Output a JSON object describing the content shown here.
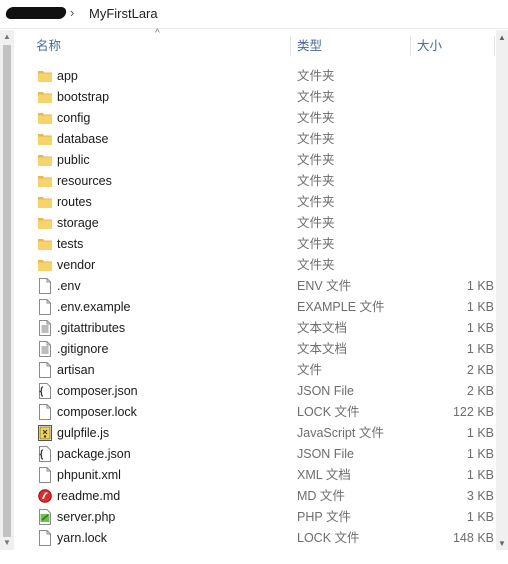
{
  "breadcrumb": {
    "separator": "›",
    "current_folder": "MyFirstLara"
  },
  "header": {
    "name": "名称",
    "type": "类型",
    "size": "大小",
    "sort_indicator": "^"
  },
  "colors": {
    "folder": "#f7d46a",
    "header_text": "#4a6a9a",
    "muted_text": "#6d6d6d"
  },
  "files": [
    {
      "name": "app",
      "type": "文件夹",
      "size": "",
      "icon": "folder-icon"
    },
    {
      "name": "bootstrap",
      "type": "文件夹",
      "size": "",
      "icon": "folder-icon"
    },
    {
      "name": "config",
      "type": "文件夹",
      "size": "",
      "icon": "folder-icon"
    },
    {
      "name": "database",
      "type": "文件夹",
      "size": "",
      "icon": "folder-icon"
    },
    {
      "name": "public",
      "type": "文件夹",
      "size": "",
      "icon": "folder-icon"
    },
    {
      "name": "resources",
      "type": "文件夹",
      "size": "",
      "icon": "folder-icon"
    },
    {
      "name": "routes",
      "type": "文件夹",
      "size": "",
      "icon": "folder-icon"
    },
    {
      "name": "storage",
      "type": "文件夹",
      "size": "",
      "icon": "folder-icon"
    },
    {
      "name": "tests",
      "type": "文件夹",
      "size": "",
      "icon": "folder-icon"
    },
    {
      "name": "vendor",
      "type": "文件夹",
      "size": "",
      "icon": "folder-icon"
    },
    {
      "name": ".env",
      "type": "ENV 文件",
      "size": "1 KB",
      "icon": "blank-file-icon"
    },
    {
      "name": ".env.example",
      "type": "EXAMPLE 文件",
      "size": "1 KB",
      "icon": "blank-file-icon"
    },
    {
      "name": ".gitattributes",
      "type": "文本文档",
      "size": "1 KB",
      "icon": "text-document-icon"
    },
    {
      "name": ".gitignore",
      "type": "文本文档",
      "size": "1 KB",
      "icon": "text-document-icon"
    },
    {
      "name": "artisan",
      "type": "文件",
      "size": "2 KB",
      "icon": "blank-file-icon"
    },
    {
      "name": "composer.json",
      "type": "JSON File",
      "size": "2 KB",
      "icon": "json-file-icon"
    },
    {
      "name": "composer.lock",
      "type": "LOCK 文件",
      "size": "122 KB",
      "icon": "blank-file-icon"
    },
    {
      "name": "gulpfile.js",
      "type": "JavaScript 文件",
      "size": "1 KB",
      "icon": "javascript-file-icon"
    },
    {
      "name": "package.json",
      "type": "JSON File",
      "size": "1 KB",
      "icon": "json-file-icon"
    },
    {
      "name": "phpunit.xml",
      "type": "XML 文档",
      "size": "1 KB",
      "icon": "blank-file-icon"
    },
    {
      "name": "readme.md",
      "type": "MD 文件",
      "size": "3 KB",
      "icon": "markdown-app-icon"
    },
    {
      "name": "server.php",
      "type": "PHP 文件",
      "size": "1 KB",
      "icon": "php-file-icon"
    },
    {
      "name": "yarn.lock",
      "type": "LOCK 文件",
      "size": "148 KB",
      "icon": "blank-file-icon"
    }
  ]
}
